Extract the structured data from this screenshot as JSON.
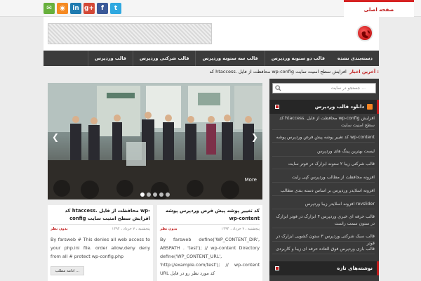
{
  "social": [
    {
      "icon": "email-icon",
      "glyph": "✉",
      "color": "#67b03c"
    },
    {
      "icon": "rss-icon",
      "glyph": "◉",
      "color": "#f58a23"
    },
    {
      "icon": "linkedin-icon",
      "glyph": "in",
      "color": "#1f7bb0"
    },
    {
      "icon": "google-plus-icon",
      "glyph": "g+",
      "color": "#d34836"
    },
    {
      "icon": "facebook-icon",
      "glyph": "f",
      "color": "#3b5998"
    },
    {
      "icon": "twitter-icon",
      "glyph": "t",
      "color": "#2fa8e0"
    }
  ],
  "topbar": {
    "home_link": "صفحه اصلی"
  },
  "nav": [
    "دسته‌بندی نشده",
    "قالب دو ستونه وردپرس",
    "قالب سه ستونه وردپرس",
    "قالب شرکتی وردپرس",
    "قالب وردپرس"
  ],
  "ticker": {
    "label": "آخرین اخبار :",
    "text": "کد htaccess. محافظت از فایل wp-config افزایش سطح امنیت سایت"
  },
  "slider": {
    "more": "More",
    "dots": 5,
    "active_dot": 0
  },
  "posts": [
    {
      "title": "کد تغییر پوشه پیش فرض وردپرس پوشه wp-content",
      "meta_date": "پنجشنبه ، ۷ خرداد ، ۱۳۹۴",
      "comments": "بدون نظر",
      "excerpt": "By farsweb define('WP_CONTENT_DIR', ABSPATH . 'test'); // wp-content Directory define('WP_CONTENT_URL', 'http://example.com/test'); // wp-content URL کد مورد نظر رو در فایل"
    },
    {
      "title": "کد htaccess. محافظت از فایل wp-config افزایش سطح امنیت سایت",
      "meta_date": "پنجشنبه ، ۷ خرداد ، ۱۳۹۴",
      "comments": "بدون نظر",
      "excerpt": "By farsweb # This denies all web access to your php.ini file. order allow,deny deny from all # protect wp-config.php",
      "read_more": "ادامه مطلب ..."
    }
  ],
  "sidebar": {
    "search_placeholder": "جستجو در سایت ...",
    "widget1_title": "دانلود قالب وردپرس",
    "items": [
      "کد htaccess. محافظت از فایل wp-config افزایش سطح امنیت سایت",
      "کد تغییر پوشه پیش فرض وردپرس پوشه wp-content",
      "لیست بهترین پینگ های وردپرس",
      "قالب شرکتی زیبا ۲ ستونه ابزارک در فوتر سایت",
      "افزونه محافظت از مطالب وردپرس کپی رایت",
      "افزونه اسلایدر وردپرس بر اساس دسته بندی مطالب",
      "افزونه اسلایدر زیبا وردپرس revslider",
      "قالب حرفه ای خبری وردپرس ۴ ابزارک در فوتر ابزارک در ستون سمت راست",
      "قالب سبک شرکتی وردپرس ۳ ستون کشویی ابزارک در فوتر",
      "قالب بازی وردپرس فوق العاده حرفه ای زیبا و کاربردی"
    ],
    "widget2_title": "نوشته‌های تازه"
  },
  "colors": {
    "accent": "#c01d1d",
    "nav_bg": "#3b3b3b",
    "sidebar_bg": "#3a3a3a"
  }
}
